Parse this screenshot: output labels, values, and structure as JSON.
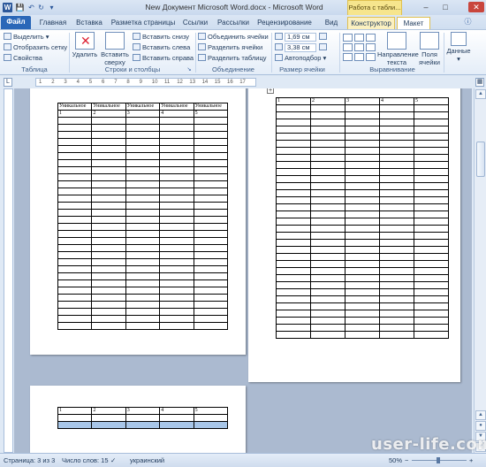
{
  "window": {
    "title": "New Документ Microsoft Word.docx - Microsoft Word",
    "contextual_group": "Работа с табли...",
    "quick_access": {
      "word_icon": "W",
      "save_icon": "save-icon",
      "undo_icon": "undo-icon",
      "redo_icon": "redo-icon",
      "customize_icon": "customize-icon"
    },
    "controls": {
      "minimize": "–",
      "maximize": "□",
      "close": "✕"
    }
  },
  "tabs": [
    "Файл",
    "Главная",
    "Вставка",
    "Разметка страницы",
    "Ссылки",
    "Рассылки",
    "Рецензирование",
    "Вид",
    "Конструктор",
    "Макет"
  ],
  "active_tab": "Макет",
  "ribbon": {
    "table_group": {
      "label": "Таблица",
      "select": "Выделить",
      "select_arrow": "▾",
      "gridlines": "Отобразить сетку",
      "properties": "Свойства"
    },
    "rows_cols_group": {
      "label": "Строки и столбцы",
      "delete": "Удалить",
      "insert_above_1": "Вставить",
      "insert_above_2": "сверху",
      "insert_below": "Вставить снизу",
      "insert_left": "Вставить слева",
      "insert_right": "Вставить справа"
    },
    "merge_group": {
      "label": "Объединение",
      "merge": "Объединить ячейки",
      "split_cells": "Разделить ячейки",
      "split_table": "Разделить таблицу"
    },
    "cell_size_group": {
      "label": "Размер ячейки",
      "height": "1,69 см",
      "width": "3,38 см",
      "autofit": "Автоподбор",
      "autofit_arrow": "▾"
    },
    "alignment_group": {
      "label": "Выравнивание",
      "direction_1": "Направление",
      "direction_2": "текста",
      "margins_1": "Поля",
      "margins_2": "ячейки"
    },
    "data_group": {
      "label": "Данные",
      "arrow": "▾"
    }
  },
  "ruler": {
    "corner": "L",
    "ticks": [
      "1",
      "2",
      "3",
      "4",
      "5",
      "6",
      "7",
      "8",
      "9",
      "10",
      "11",
      "12",
      "13",
      "14",
      "15",
      "16",
      "17"
    ]
  },
  "page1_table": {
    "header": [
      "Уникальное",
      "Уникальное",
      "Уникальное",
      "Уникальное",
      "Уникальное"
    ],
    "numbers": [
      "1",
      "2",
      "3",
      "4",
      "5"
    ]
  },
  "page2_table": {
    "numbers": [
      "1",
      "2",
      "3",
      "4",
      "5"
    ]
  },
  "page3_table": {
    "numbers": [
      "1",
      "2",
      "3",
      "4",
      "5"
    ]
  },
  "status": {
    "page": "Страница: 3 из 3",
    "words": "Число слов: 15",
    "language": "украинский",
    "zoom": "50%",
    "zoom_minus": "−",
    "zoom_plus": "+"
  },
  "watermark": "user-life.com"
}
